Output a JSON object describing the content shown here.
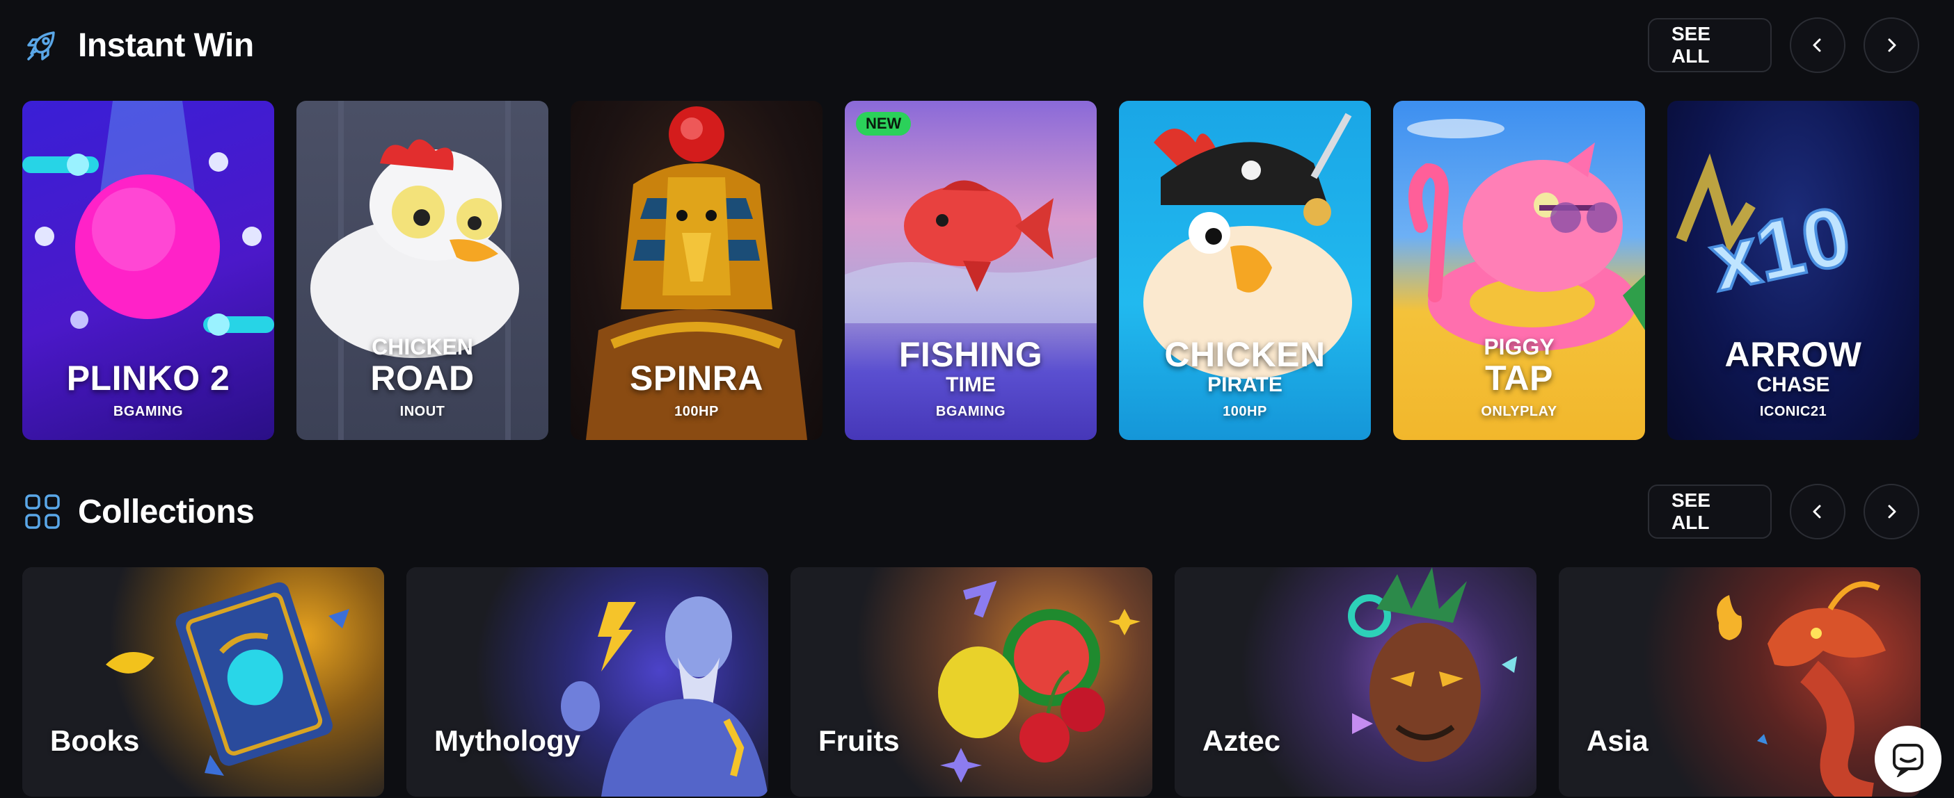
{
  "instant_win": {
    "title": "Instant Win",
    "see_all": "SEE ALL",
    "icon": "rocket-icon",
    "games": [
      {
        "top": "",
        "main": "PLINKO 2",
        "sub": "",
        "provider": "BGAMING",
        "badge": ""
      },
      {
        "top": "CHICKEN",
        "main": "ROAD",
        "sub": "",
        "provider": "INOUT",
        "badge": ""
      },
      {
        "top": "",
        "main": "SPINRA",
        "sub": "",
        "provider": "100HP",
        "badge": ""
      },
      {
        "top": "",
        "main": "FISHING",
        "sub": "TIME",
        "provider": "BGAMING",
        "badge": "NEW"
      },
      {
        "top": "",
        "main": "CHICKEN",
        "sub": "PIRATE",
        "provider": "100HP",
        "badge": ""
      },
      {
        "top": "PIGGY",
        "main": "TAP",
        "sub": "",
        "provider": "ONLYPLAY",
        "badge": ""
      },
      {
        "top": "",
        "main": "ARROW",
        "sub": "CHASE",
        "provider": "ICONIC21",
        "badge": ""
      }
    ]
  },
  "collections": {
    "title": "Collections",
    "see_all": "SEE ALL",
    "icon": "grid-icon",
    "items": [
      {
        "name": "Books"
      },
      {
        "name": "Mythology"
      },
      {
        "name": "Fruits"
      },
      {
        "name": "Aztec"
      },
      {
        "name": "Asia"
      }
    ]
  },
  "colors": {
    "background": "#0d0e12",
    "accent_icon": "#5aa7e8",
    "badge_new": "#2bd15a"
  },
  "chat": {
    "icon": "chat-icon"
  }
}
